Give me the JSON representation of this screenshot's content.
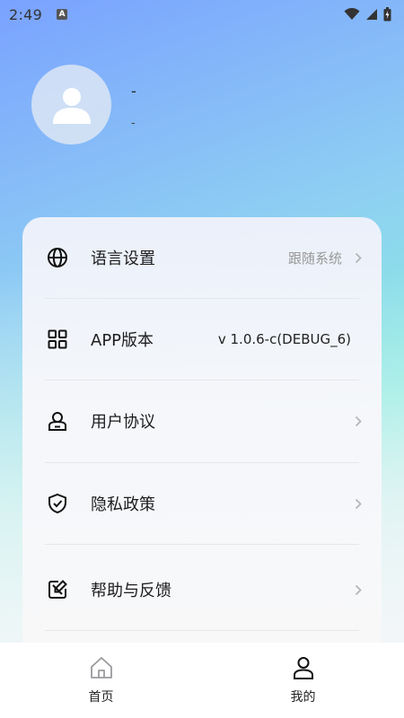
{
  "status_bar": {
    "time": "2:49",
    "notif_letter": "A"
  },
  "profile": {
    "name": "-",
    "subtitle": "-"
  },
  "menu": [
    {
      "label": "语言设置",
      "value": "跟随系统",
      "icon": "globe-icon",
      "chevron": true
    },
    {
      "label": "APP版本",
      "value": "v 1.0.6-c(DEBUG_6)",
      "icon": "grid-icon",
      "chevron": false
    },
    {
      "label": "用户协议",
      "value": "",
      "icon": "user-badge-icon",
      "chevron": true
    },
    {
      "label": "隐私政策",
      "value": "",
      "icon": "shield-check-icon",
      "chevron": true
    },
    {
      "label": "帮助与反馈",
      "value": "",
      "icon": "feedback-edit-icon",
      "chevron": true
    }
  ],
  "bottom_nav": {
    "home_label": "首页",
    "mine_label": "我的",
    "active": "mine"
  },
  "colors": {
    "gradient_start": "#7aa2ff",
    "gradient_end": "#86ece0",
    "text_primary": "#1d1d1f",
    "text_secondary": "#999999"
  }
}
